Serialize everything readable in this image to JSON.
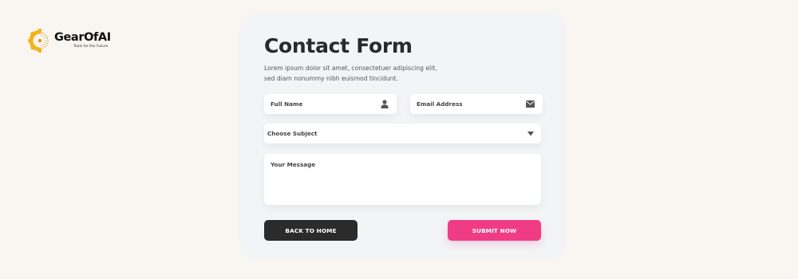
{
  "brand": {
    "name": "GearOfAI",
    "tagline": "Tools for the Future",
    "color_primary": "#f2b31e",
    "color_secondary": "#e49417"
  },
  "form": {
    "title": "Contact Form",
    "description": "Lorem ipsum dolor sit amet, consectetuer adipiscing elit, sed diam nonummy nibh euismod tincidunt.",
    "full_name_placeholder": "Full Name",
    "full_name_icon": "user-icon",
    "email_placeholder": "Email Address",
    "email_icon": "mail-icon",
    "subject_selected": "Choose Subject",
    "subject_icon": "caret-down-icon",
    "message_placeholder": "Your Message",
    "back_label": "BACK TO HOME",
    "submit_label": "SUBMIT NOW"
  },
  "colors": {
    "page_background": "#f9f5f1",
    "card_background": "#f3f4f6",
    "back_button": "#2b2b2b",
    "submit_button": "#f03c84"
  }
}
